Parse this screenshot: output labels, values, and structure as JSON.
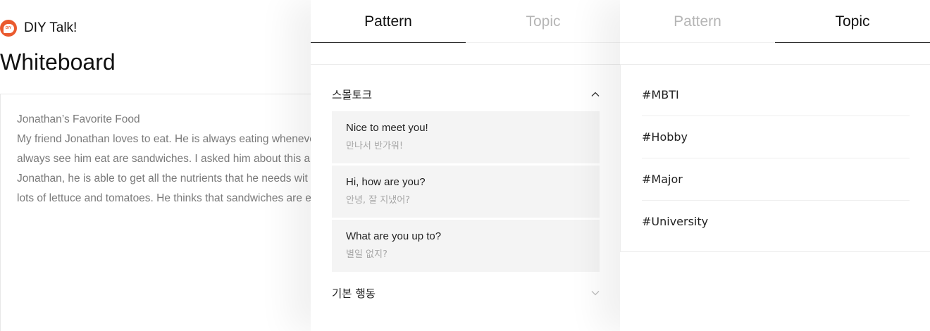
{
  "brand": {
    "name": "DIY Talk!",
    "logo_text": "DIY",
    "accent": "#ea5a2e"
  },
  "page": {
    "title": "Whiteboard"
  },
  "whiteboard": {
    "lines": [
      "Jonathan’s Favorite Food",
      "My friend Jonathan loves to eat. He is always eating wheneve",
      "always see him eat are sandwiches. I asked him about this an",
      "Jonathan, he is able to get all the nutrients that he needs wit",
      "lots of lettuce and tomatoes. He thinks that sandwiches are e"
    ]
  },
  "pattern_panel": {
    "tabs": [
      {
        "label": "Pattern",
        "active": true
      },
      {
        "label": "Topic",
        "active": false
      }
    ],
    "sections": [
      {
        "title": "스몰토크",
        "expanded": true,
        "chevron": "chevron-up-icon",
        "items": [
          {
            "en": "Nice to meet you!",
            "ko": "만나서 반가워!"
          },
          {
            "en": "Hi, how are you?",
            "ko": "안녕, 잘 지냈어?"
          },
          {
            "en": "What are you up to?",
            "ko": "별일 없지?"
          }
        ]
      },
      {
        "title": "기본 행동",
        "expanded": false,
        "chevron": "chevron-down-icon"
      }
    ]
  },
  "topic_panel": {
    "tabs": [
      {
        "label": "Pattern",
        "active": false
      },
      {
        "label": "Topic",
        "active": true
      }
    ],
    "topics": [
      "#MBTI",
      "#Hobby",
      "#Major",
      "#University"
    ]
  }
}
